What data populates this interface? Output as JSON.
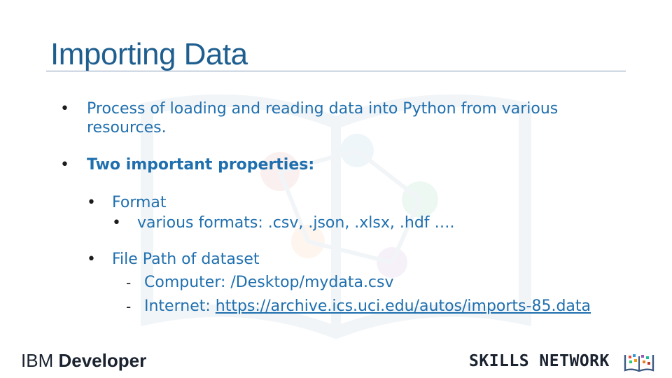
{
  "slide": {
    "title": "Importing Data",
    "bullets": {
      "b1_line1": "Process of loading and reading data into Python from various",
      "b1_line2": "resources.",
      "b2": "Two important properties:",
      "format_label": "Format",
      "format_detail": "various formats: .csv, .json, .xlsx, .hdf ….",
      "filepath_label": "File Path of dataset",
      "computer_label": "Computer: /Desktop/mydata.csv",
      "internet_prefix": "Internet: ",
      "internet_url": "https://archive.ics.uci.edu/autos/imports-85.data"
    },
    "markers": {
      "bullet": "•",
      "dash": "-"
    }
  },
  "footer": {
    "ibm_prefix": "IBM",
    "ibm_brand": "Developer",
    "skills_network": "SKILLS NETWORK"
  },
  "colors": {
    "title": "#1f5f8f",
    "body_text": "#1f6fae",
    "rule": "#7f97b4",
    "footer_text": "#1b2330"
  }
}
